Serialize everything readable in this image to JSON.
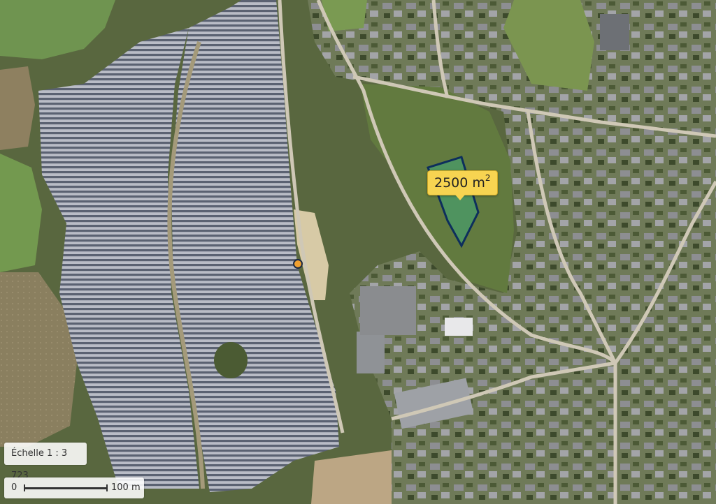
{
  "map": {
    "measurement": {
      "area_value": "2500 m",
      "area_unit_exponent": "2",
      "fill_color": "#3fa87a",
      "stroke_color": "#0d2e5c"
    },
    "marker": {
      "color": "#f0a030"
    },
    "scale": {
      "ratio_text": "Échelle 1 : 3 723",
      "zero_label": "0",
      "distance_label": "100 m"
    }
  }
}
